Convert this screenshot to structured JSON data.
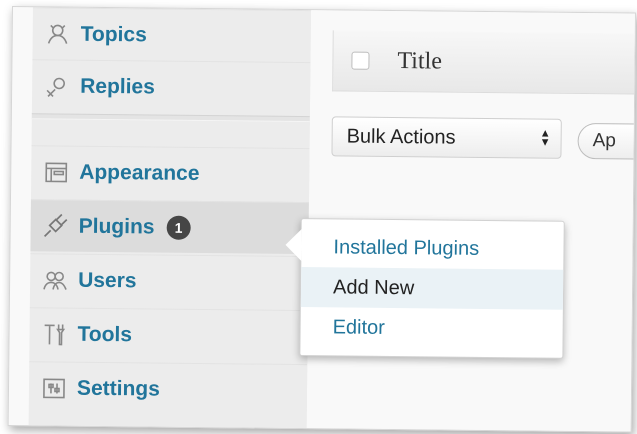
{
  "sidebar": {
    "items": [
      {
        "label": "Topics",
        "icon": "topics-icon"
      },
      {
        "label": "Replies",
        "icon": "replies-icon"
      },
      {
        "label": "Appearance",
        "icon": "appearance-icon"
      },
      {
        "label": "Plugins",
        "icon": "plugins-icon",
        "badge": "1"
      },
      {
        "label": "Users",
        "icon": "users-icon"
      },
      {
        "label": "Tools",
        "icon": "tools-icon"
      },
      {
        "label": "Settings",
        "icon": "settings-icon"
      }
    ]
  },
  "list_table": {
    "title_header": "Title"
  },
  "bulk_actions": {
    "selected": "Bulk Actions",
    "apply_label": "Ap"
  },
  "flyout": {
    "items": [
      {
        "label": "Installed Plugins"
      },
      {
        "label": "Add New"
      },
      {
        "label": "Editor"
      }
    ]
  },
  "colors": {
    "link": "#21759b",
    "badge_bg": "#464646",
    "sidebar_bg": "#ececec"
  }
}
